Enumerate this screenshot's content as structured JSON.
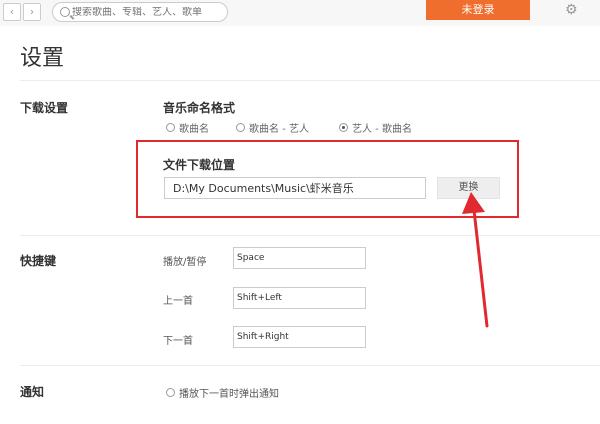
{
  "topbar": {
    "back_glyph": "‹",
    "forward_glyph": "›",
    "search_placeholder": "搜索歌曲、专辑、艺人、歌单",
    "login_label": "未登录",
    "settings_glyph": "⚙"
  },
  "page": {
    "title": "设置"
  },
  "download": {
    "section_label": "下载设置",
    "naming_title": "音乐命名格式",
    "naming_options": [
      "歌曲名",
      "歌曲名 - 艺人",
      "艺人 - 歌曲名"
    ],
    "naming_selected": "艺人 - 歌曲名",
    "location_title": "文件下载位置",
    "location_value": "D:\\My Documents\\Music\\虾米音乐",
    "change_label": "更换"
  },
  "shortcuts": {
    "section_label": "快捷键",
    "items": [
      {
        "label": "播放/暂停",
        "value": "Space"
      },
      {
        "label": "上一首",
        "value": "Shift+Left"
      },
      {
        "label": "下一首",
        "value": "Shift+Right"
      }
    ]
  },
  "notify": {
    "section_label": "通知",
    "option_label": "播放下一首时弹出通知"
  },
  "colors": {
    "accent": "#f06e2d",
    "highlight": "#e02a30"
  }
}
